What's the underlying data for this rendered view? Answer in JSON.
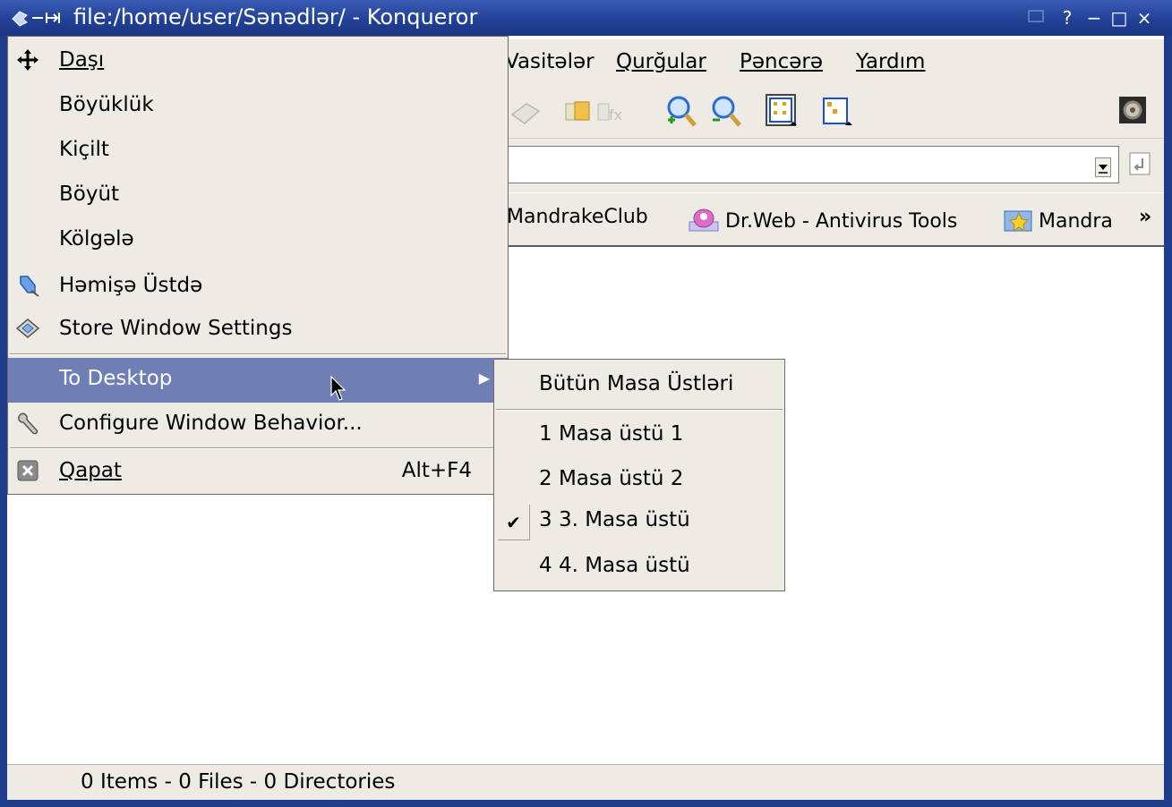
{
  "window": {
    "title": "file:/home/user/Sənədlər/ - Konqueror",
    "title_buttons": [
      "?",
      "−",
      "□",
      "×"
    ]
  },
  "menubar": {
    "items": [
      {
        "label": "Vasitələr"
      },
      {
        "label": "Qurğular"
      },
      {
        "label": "Pəncərə"
      },
      {
        "label": "Yardım"
      }
    ]
  },
  "toolbar": {
    "icons": [
      "print-icon",
      "copy-icon",
      "paste-icon",
      "zoom-in-icon",
      "zoom-out-icon",
      "icon-view-icon",
      "tree-view-icon",
      "throbber-icon"
    ]
  },
  "location": {
    "value": ""
  },
  "bookmarks": {
    "items": [
      {
        "label": "MandrakeClub"
      },
      {
        "label": "Dr.Web - Antivirus Tools"
      },
      {
        "label": "Mandra"
      }
    ],
    "more": "»"
  },
  "status": {
    "text": "0 Items - 0 Files - 0 Directories"
  },
  "window_menu": {
    "items": [
      {
        "label": "Daşı",
        "icon": "move-icon"
      },
      {
        "label": "Böyüklük"
      },
      {
        "label": "Kiçilt"
      },
      {
        "label": "Böyüt"
      },
      {
        "label": "Kölgələ"
      },
      {
        "label": "Həmişə Üstdə",
        "icon": "pin-icon"
      },
      {
        "label": "Store Window Settings",
        "icon": "store-settings-icon"
      },
      {
        "label": "To Desktop",
        "active": true,
        "submenu": true
      },
      {
        "label": "Configure Window Behavior...",
        "icon": "wrench-icon"
      },
      {
        "label": "Qapat",
        "accel": "Alt+F4",
        "icon": "close-window-icon"
      }
    ]
  },
  "desktop_submenu": {
    "items": [
      {
        "label": "Bütün Masa Üstləri"
      },
      {
        "label": "1  Masa üstü 1"
      },
      {
        "label": "2  Masa üstü 2"
      },
      {
        "label": "3  3. Masa üstü",
        "checked": true
      },
      {
        "label": "4  4. Masa üstü"
      }
    ],
    "check": "✔"
  },
  "colors": {
    "titlebar": "#203f95",
    "menu_bg": "#eeeae4",
    "highlight": "#6f7fb6"
  }
}
